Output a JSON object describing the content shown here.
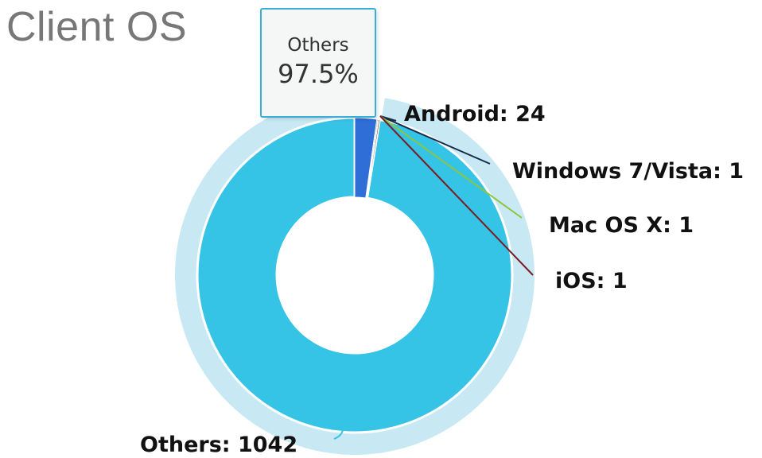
{
  "title": "Client OS",
  "tooltip": {
    "name": "Others",
    "value": "97.5%"
  },
  "chart_data": {
    "type": "pie",
    "title": "Client OS",
    "donut": true,
    "slices": [
      {
        "name": "Others",
        "value": 1042,
        "label": "Others: 1042",
        "color": "#35c3e6",
        "hovered": true
      },
      {
        "name": "Android",
        "value": 24,
        "label": "Android: 24",
        "color": "#2f6ed6"
      },
      {
        "name": "Windows 7/Vista",
        "value": 1,
        "label": "Windows 7/Vista: 1",
        "color": "#1a2b4a"
      },
      {
        "name": "Mac OS X",
        "value": 1,
        "label": "Mac OS X: 1",
        "color": "#8cc63f"
      },
      {
        "name": "iOS",
        "value": 1,
        "label": "iOS: 1",
        "color": "#7a1c22"
      }
    ],
    "halo_color": "#c8e9f3"
  }
}
